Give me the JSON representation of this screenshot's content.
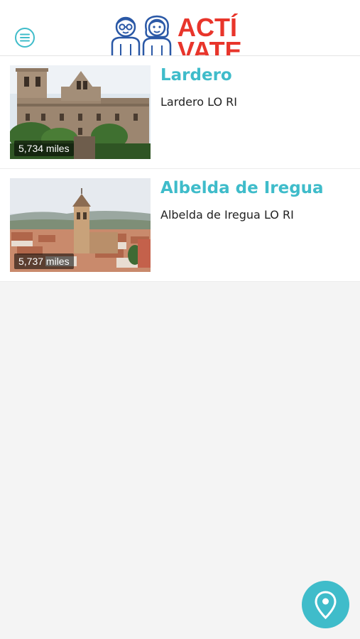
{
  "header": {
    "logo_text_line1": "ACTÍ",
    "logo_text_line2": "VATE"
  },
  "places": [
    {
      "name": "Lardero",
      "location": "Lardero LO RI",
      "distance": "5,734 miles"
    },
    {
      "name": "Albelda de Iregua",
      "location": "Albelda de Iregua LO RI",
      "distance": "5,737 miles"
    }
  ],
  "colors": {
    "accent": "#3fbcca",
    "logo_red": "#e8352b",
    "background": "#f4f4f4"
  },
  "icons": {
    "menu": "menu-icon",
    "map": "map-pin-icon"
  }
}
